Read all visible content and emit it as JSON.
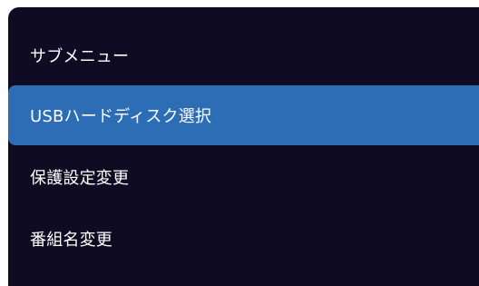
{
  "submenu": {
    "items": [
      {
        "label": "サブメニュー",
        "selected": false
      },
      {
        "label": "USBハードディスク選択",
        "selected": true
      },
      {
        "label": "保護設定変更",
        "selected": false
      },
      {
        "label": "番組名変更",
        "selected": false
      }
    ]
  },
  "colors": {
    "panel_background": "#0f0b22",
    "selected_highlight": "#2c6db6",
    "text": "#ffffff"
  }
}
